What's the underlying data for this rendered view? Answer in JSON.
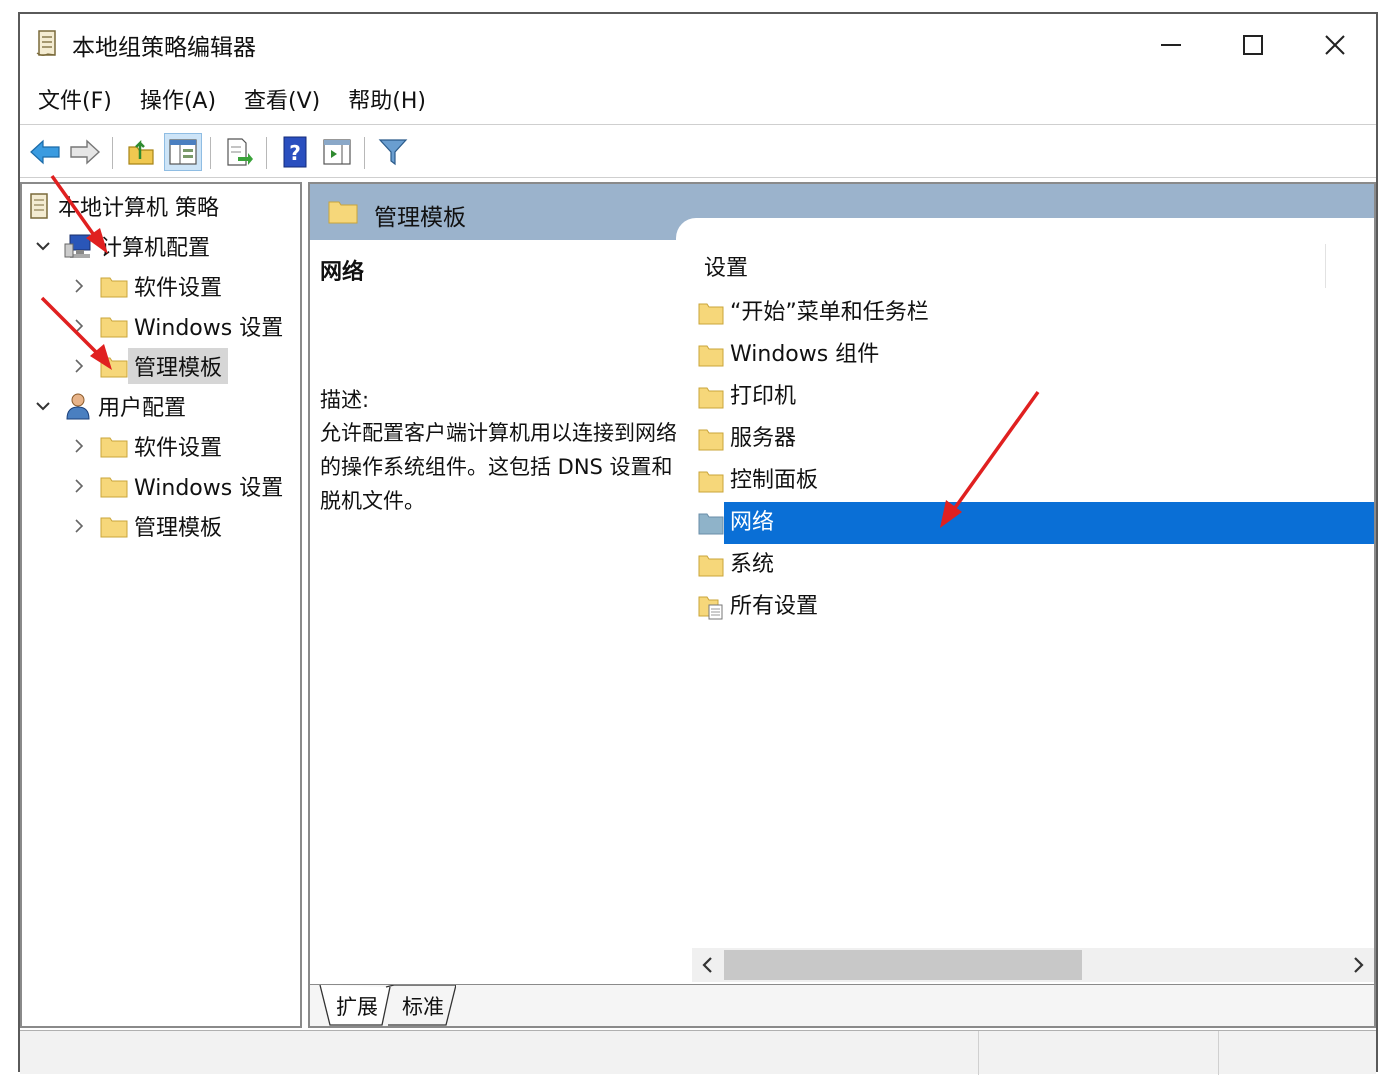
{
  "window": {
    "title": "本地组策略编辑器",
    "minimize_label": "minimize",
    "maximize_label": "maximize",
    "close_label": "close"
  },
  "menu": {
    "items": [
      "文件(F)",
      "操作(A)",
      "查看(V)",
      "帮助(H)"
    ]
  },
  "toolbar": {
    "buttons": [
      "back-icon",
      "forward-icon",
      "up-folder-icon",
      "show-hide-tree-icon",
      "export-list-icon",
      "help-icon",
      "show-action-pane-icon",
      "filter-icon"
    ],
    "active_button": "show-hide-tree-icon"
  },
  "tree": {
    "root": "本地计算机 策略",
    "computer_config": "计算机配置",
    "computer_children": [
      "软件设置",
      "Windows 设置",
      "管理模板"
    ],
    "user_config": "用户配置",
    "user_children": [
      "软件设置",
      "Windows 设置",
      "管理模板"
    ],
    "selected": "管理模板"
  },
  "main": {
    "header_title": "管理模板",
    "desc_title": "网络",
    "desc_label": "描述:",
    "desc_body": "允许配置客户端计算机用以连接到网络的操作系统组件。这包括 DNS 设置和脱机文件。",
    "column_header": "设置",
    "items": [
      "“开始”菜单和任务栏",
      "Windows 组件",
      "打印机",
      "服务器",
      "控制面板",
      "网络",
      "系统",
      "所有设置"
    ],
    "selected_item": "网络"
  },
  "tabs": [
    "扩展",
    "标准"
  ],
  "colors": {
    "header_bg": "#9bb3cc",
    "selection": "#0a6fd6",
    "folder": "#f6d77a",
    "arrow": "#e02020"
  }
}
